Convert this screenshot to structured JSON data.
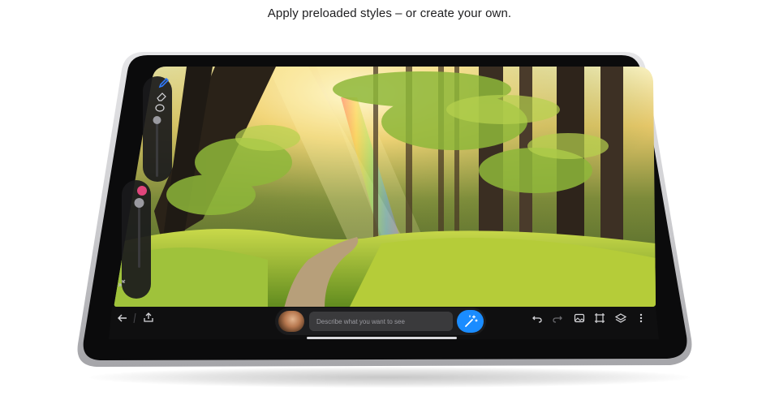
{
  "headline": "Apply preloaded styles – or create your own.",
  "prompt": {
    "placeholder": "Describe what you want to see"
  },
  "colors": {
    "accent": "#1a8cff",
    "brush_color": "#e0457b",
    "tool_active": "#2f7bff",
    "toolbar_bg": "#1c1c1e",
    "field_bg": "#3a3a3c",
    "text_primary": "#1d1d1f"
  },
  "icons": {
    "sidebar": [
      "pencil-icon",
      "eraser-icon",
      "lasso-icon",
      "collapse-icon"
    ],
    "toolbar_left": [
      "back-arrow-icon",
      "share-icon"
    ],
    "toolbar_right": [
      "undo-icon",
      "redo-icon",
      "add-image-icon",
      "crop-icon",
      "layers-icon",
      "more-icon"
    ],
    "prompt": [
      "avatar",
      "magic-wand-icon"
    ]
  }
}
